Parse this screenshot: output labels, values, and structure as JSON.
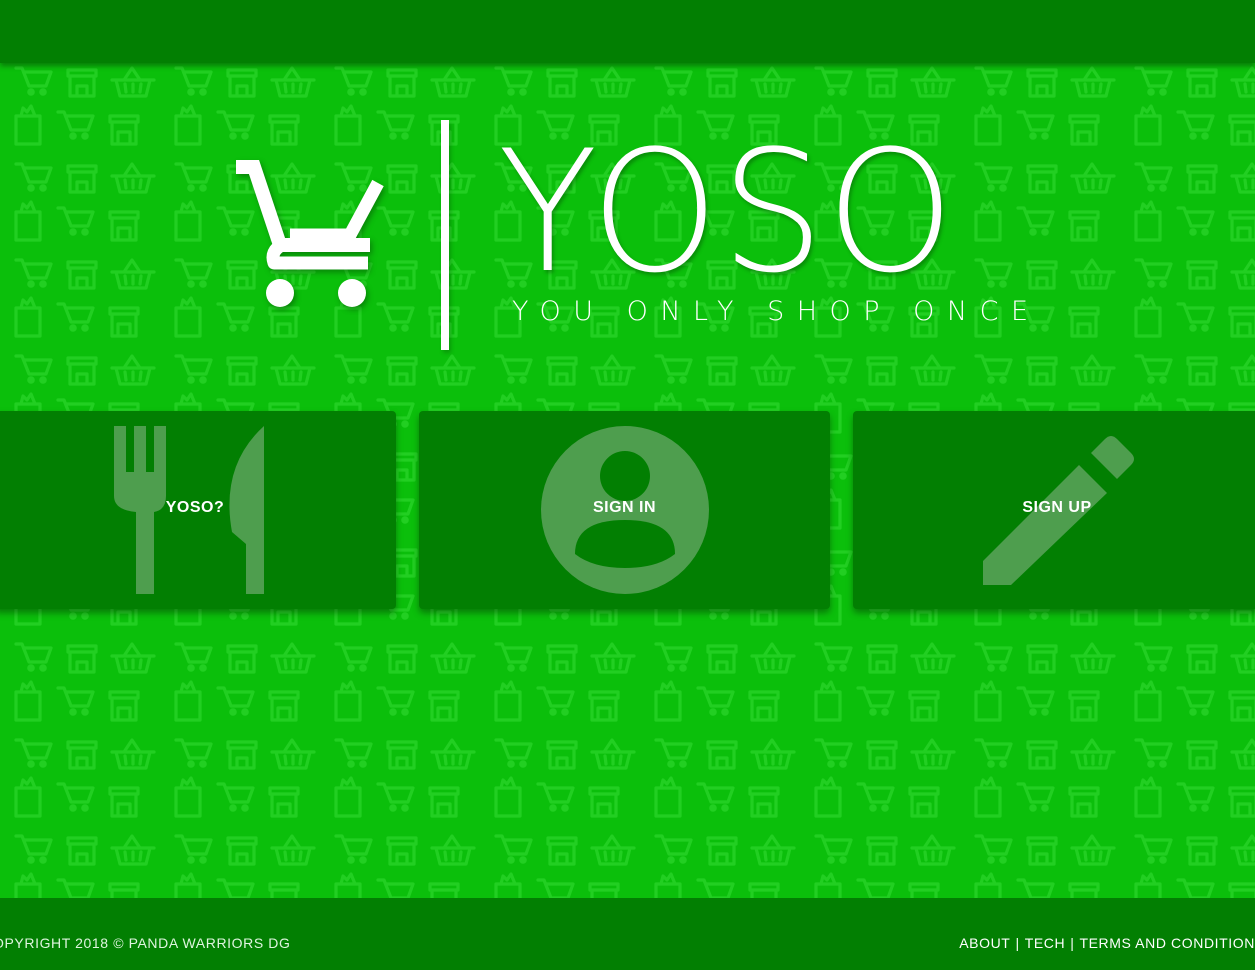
{
  "brand": {
    "name": "YOSO",
    "tagline": "YOU ONLY SHOP ONCE"
  },
  "cards": [
    {
      "label": "YOSO?",
      "icon": "fork-knife-icon"
    },
    {
      "label": "SIGN IN",
      "icon": "user-avatar-icon"
    },
    {
      "label": "SIGN UP",
      "icon": "pencil-icon"
    }
  ],
  "footer": {
    "copyright": "OPYRIGHT 2018 © PANDA WARRIORS DG",
    "links": [
      "ABOUT",
      "TECH",
      "TERMS AND CONDITION"
    ],
    "separator": "|"
  },
  "colors": {
    "background": "#0bbf0b",
    "bar": "#027f02",
    "text": "#ffffff"
  }
}
